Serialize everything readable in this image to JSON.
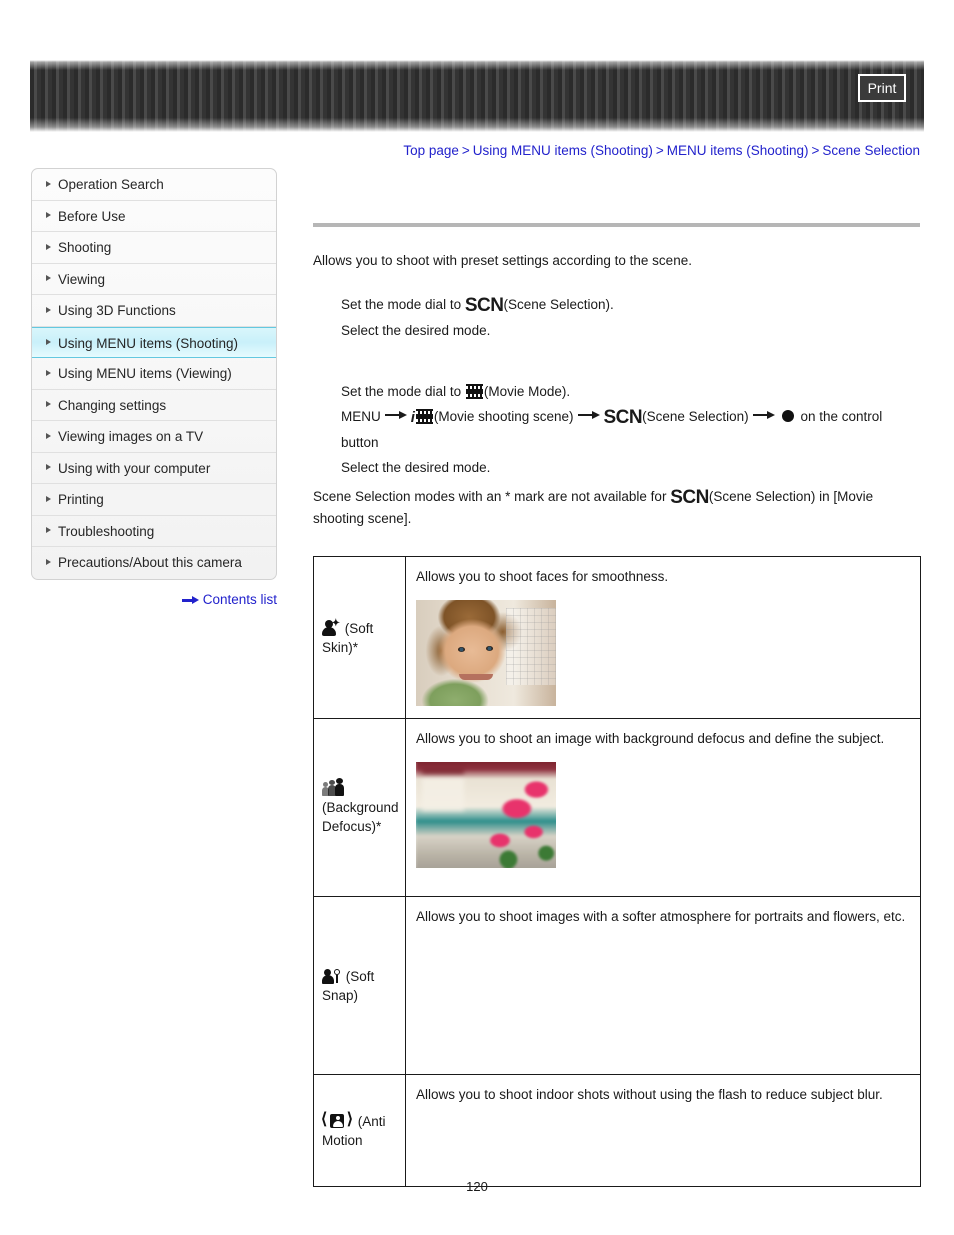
{
  "header": {
    "print_label": "Print"
  },
  "breadcrumb": {
    "items": [
      {
        "label": "Top page"
      },
      {
        "label": "Using MENU items (Shooting)"
      },
      {
        "label": "MENU items (Shooting)"
      },
      {
        "label": "Scene Selection"
      }
    ],
    "separator": ">"
  },
  "sidebar": {
    "items": [
      {
        "label": "Operation Search",
        "active": false
      },
      {
        "label": "Before Use",
        "active": false
      },
      {
        "label": "Shooting",
        "active": false
      },
      {
        "label": "Viewing",
        "active": false
      },
      {
        "label": "Using 3D Functions",
        "active": false
      },
      {
        "label": "Using MENU items (Shooting)",
        "active": true
      },
      {
        "label": "Using MENU items (Viewing)",
        "active": false
      },
      {
        "label": "Changing settings",
        "active": false
      },
      {
        "label": "Viewing images on a TV",
        "active": false
      },
      {
        "label": "Using with your computer",
        "active": false
      },
      {
        "label": "Printing",
        "active": false
      },
      {
        "label": "Troubleshooting",
        "active": false
      },
      {
        "label": "Precautions/About this camera",
        "active": false
      }
    ],
    "contents_list_label": "Contents list",
    "highlight_color": "#c9f0fa",
    "link_color": "#2222cc"
  },
  "main": {
    "intro": "Allows you to shoot with preset settings according to the scene.",
    "still_steps": {
      "step1_before": "Set the mode dial to",
      "step1_icon": "scn-icon",
      "step1_after": "(Scene Selection).",
      "step2": "Select the desired mode."
    },
    "movie_steps": {
      "step1_before": "Set the mode dial to",
      "step1_icon": "movie-mode-icon",
      "step1_after": "(Movie Mode).",
      "step2_menu": "MENU",
      "step2_movie_scene": "(Movie shooting scene)",
      "step2_scene_selection": "(Scene Selection)",
      "step2_tail": "on the control",
      "step2_tail2": "button",
      "step3": "Select the desired mode."
    },
    "footnote_before": "Scene Selection modes with an * mark are not available for",
    "footnote_after": "(Scene Selection) in [Movie",
    "footnote_line2": "shooting scene]."
  },
  "table": {
    "rows": [
      {
        "mode_icon": "soft-skin-icon",
        "mode_label": "(Soft Skin)*",
        "description": "Allows you to shoot faces for smoothness.",
        "thumbnail": "boy-portrait-photo",
        "has_thumbnail": true
      },
      {
        "mode_icon": "background-defocus-icon",
        "mode_label": "(Background Defocus)*",
        "description": "Allows you to shoot an image with background defocus and define the subject.",
        "thumbnail": "flowers-building-photo",
        "has_thumbnail": true
      },
      {
        "mode_icon": "soft-snap-icon",
        "mode_label": "(Soft Snap)",
        "description": "Allows you to shoot images with a softer atmosphere for portraits and flowers, etc.",
        "thumbnail": "boy-in-grass-photo",
        "has_thumbnail": true
      },
      {
        "mode_icon": "anti-motion-icon",
        "mode_label": "(Anti Motion",
        "description": "Allows you to shoot indoor shots without using the flash to reduce subject blur.",
        "thumbnail": "",
        "has_thumbnail": false
      }
    ]
  },
  "footer": {
    "page_number": "120"
  }
}
